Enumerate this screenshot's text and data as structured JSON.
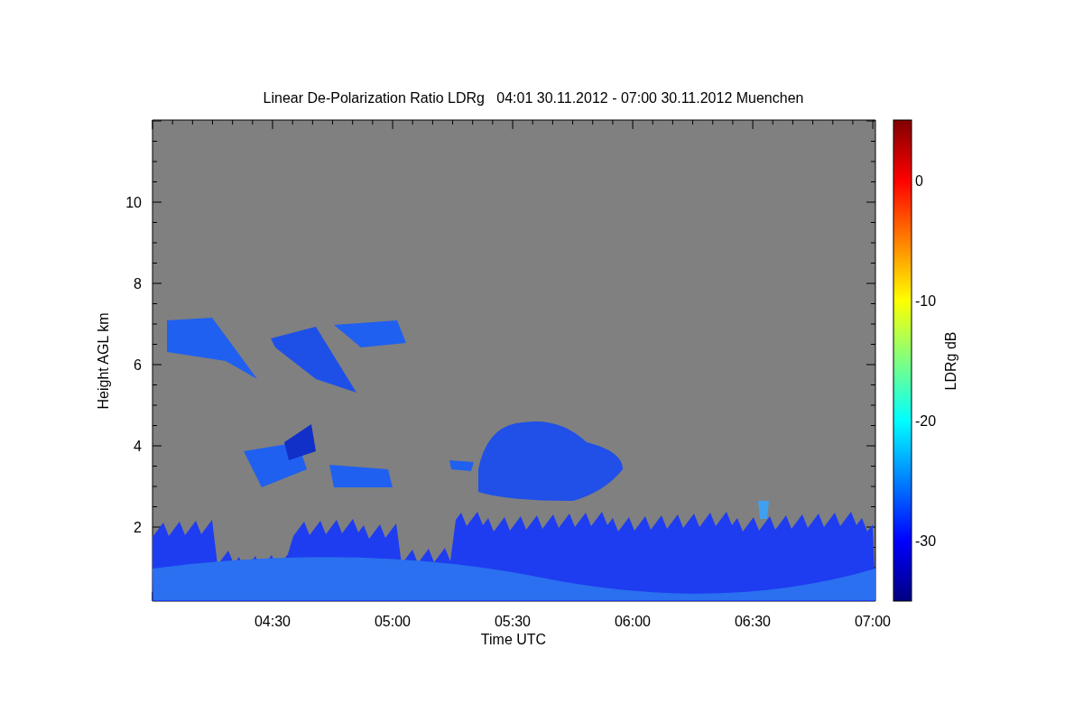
{
  "title": "Linear De-Polarization Ratio LDRg   04:01 30.11.2012 - 07:00 30.11.2012 Muenchen",
  "x_axis": {
    "label": "Time UTC",
    "ticks": [
      "04:30",
      "05:00",
      "05:30",
      "06:00",
      "06:30",
      "07:00"
    ]
  },
  "y_axis": {
    "label": "Height AGL km",
    "ticks": [
      "10",
      "8",
      "6",
      "4",
      "2"
    ]
  },
  "colorbar": {
    "label": "LDRg dB",
    "ticks": [
      "0",
      "-10",
      "-20",
      "-30"
    ]
  }
}
